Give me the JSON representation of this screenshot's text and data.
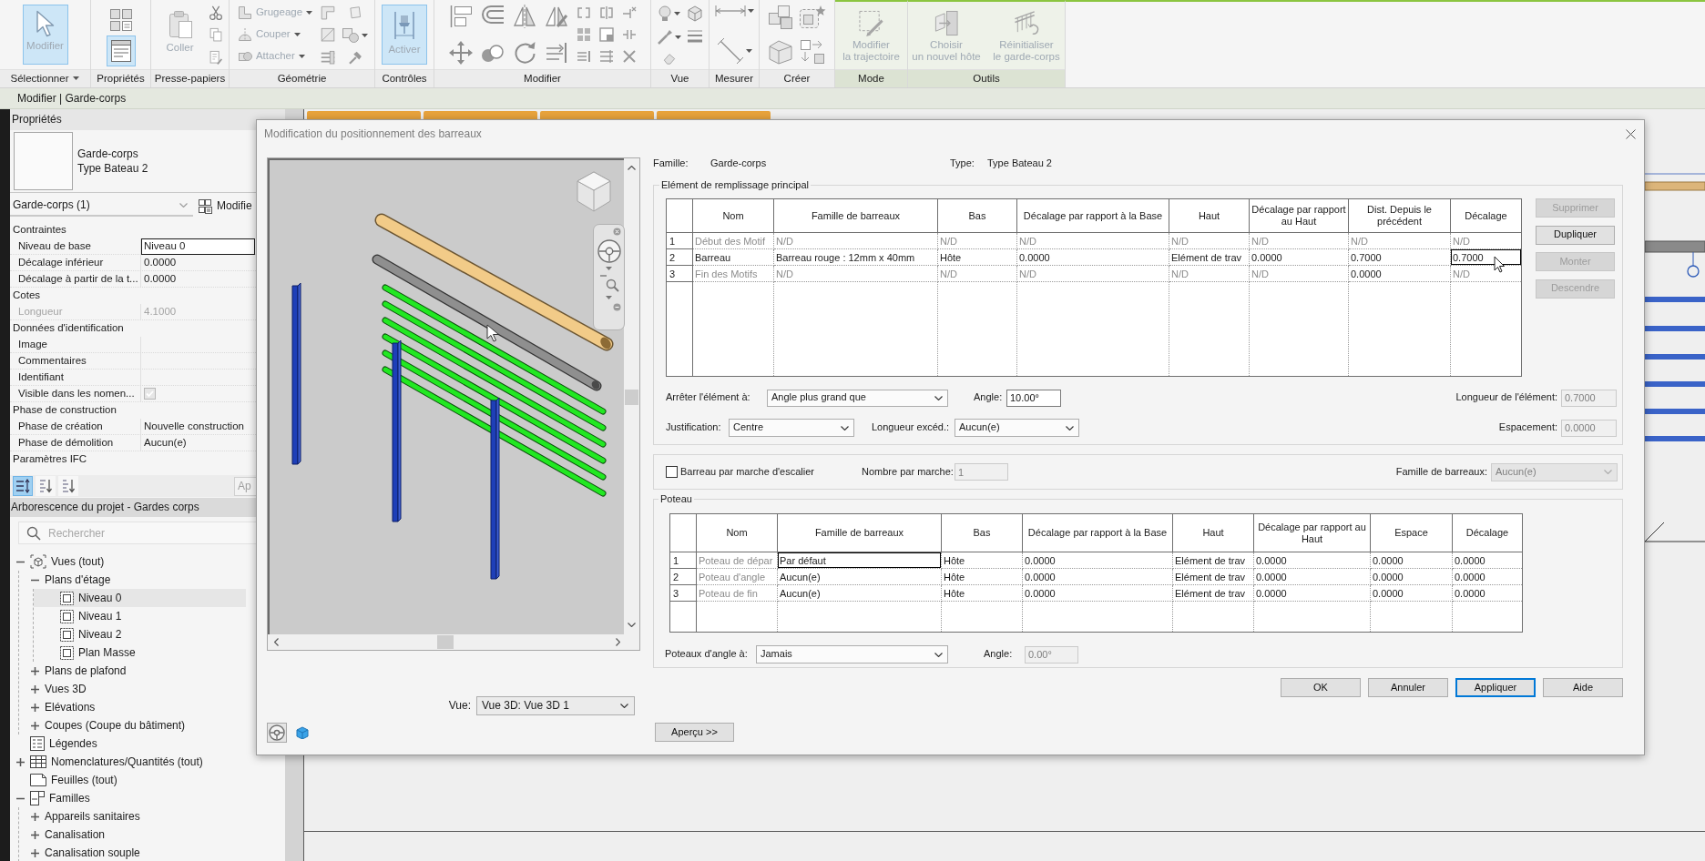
{
  "ribbon": {
    "panels": [
      {
        "label": "Sélectionner",
        "dropdown": true,
        "contextual": false,
        "buttons": [
          {
            "label": "Modifier",
            "selected": true,
            "disabled": true
          }
        ]
      },
      {
        "label": "Propriétés",
        "dropdown": false,
        "contextual": false,
        "tools": [
          {
            "selected": false
          },
          {
            "selected": true
          }
        ]
      },
      {
        "label": "Presse-papiers",
        "dropdown": false,
        "contextual": false,
        "buttons": [
          {
            "label": "Coller",
            "selected": false,
            "disabled": true
          }
        ]
      },
      {
        "label": "Géométrie",
        "dropdown": false,
        "contextual": false,
        "buttons": [
          {
            "label": "Grugeage",
            "selected": false,
            "disabled": true
          },
          {
            "label": "Couper",
            "selected": false,
            "disabled": true
          },
          {
            "label": "Attacher",
            "selected": false,
            "disabled": true
          }
        ]
      },
      {
        "label": "Contrôles",
        "dropdown": false,
        "contextual": false,
        "buttons": [
          {
            "label": "Activer",
            "selected": true,
            "disabled": true
          }
        ]
      },
      {
        "label": "Modifier",
        "dropdown": false,
        "contextual": false
      },
      {
        "label": "Vue",
        "dropdown": false,
        "contextual": false
      },
      {
        "label": "Mesurer",
        "dropdown": false,
        "contextual": false
      },
      {
        "label": "Créer",
        "dropdown": false,
        "contextual": false
      },
      {
        "label": "Mode",
        "dropdown": false,
        "contextual": true,
        "buttons": [
          {
            "label": "Modifier\nla trajectoire",
            "selected": false,
            "disabled": true
          }
        ]
      },
      {
        "label": "Outils",
        "dropdown": false,
        "contextual": true,
        "buttons": [
          {
            "label": "Choisir\nun nouvel hôte",
            "selected": false,
            "disabled": true
          },
          {
            "label": "Réinitialiser\nle garde-corps",
            "selected": false,
            "disabled": true
          }
        ]
      }
    ]
  },
  "context_bar": {
    "text": "Modifier | Garde-corps"
  },
  "properties": {
    "title": "Propriétés",
    "type_family": "Garde-corps",
    "type_name": "Type Bateau 2",
    "instance_selector": "Garde-corps (1)",
    "edit_type_button": "Modifie",
    "groups": [
      {
        "name": "Contraintes",
        "rows": [
          {
            "label": "Niveau de base",
            "value": "Niveau 0",
            "kind": "text",
            "focused": true,
            "disabled": false
          },
          {
            "label": "Décalage inférieur",
            "value": "0.0000",
            "kind": "text",
            "focused": false,
            "disabled": false
          },
          {
            "label": "Décalage à partir de la t...",
            "value": "0.0000",
            "kind": "text",
            "focused": false,
            "disabled": false
          }
        ]
      },
      {
        "name": "Cotes",
        "rows": [
          {
            "label": "Longueur",
            "value": "4.1000",
            "kind": "text",
            "focused": false,
            "disabled": true
          }
        ]
      },
      {
        "name": "Données d'identification",
        "rows": [
          {
            "label": "Image",
            "kind": "text",
            "focused": false,
            "disabled": false
          },
          {
            "label": "Commentaires",
            "kind": "text",
            "focused": false,
            "disabled": false
          },
          {
            "label": "Identifiant",
            "kind": "text",
            "focused": false,
            "disabled": false
          },
          {
            "label": "Visible dans les nomen...",
            "kind": "checkbox",
            "checked": true,
            "focused": false,
            "disabled": true
          }
        ]
      },
      {
        "name": "Phase de construction",
        "rows": [
          {
            "label": "Phase de création",
            "value": "Nouvelle construction",
            "kind": "text",
            "focused": false,
            "disabled": false
          },
          {
            "label": "Phase de démolition",
            "value": "Aucun(e)",
            "kind": "text",
            "focused": false,
            "disabled": false
          }
        ]
      },
      {
        "name": "Paramètres IFC"
      }
    ],
    "sort_tools": [
      {
        "selected": true
      },
      {
        "selected": false
      },
      {
        "selected": false
      }
    ],
    "apply_button": "Ap"
  },
  "project_browser": {
    "title": "Arborescence du projet - Gardes corps",
    "search": {
      "placeholder": "Rechercher"
    },
    "tree": [
      {
        "label": "Vues (tout)",
        "kind": "views",
        "expanded": true,
        "selected": false,
        "children": [
          {
            "label": "Plans d'étage",
            "expanded": true,
            "selected": false,
            "children": [
              {
                "label": "Niveau 0",
                "kind": "plan",
                "selected": true
              },
              {
                "label": "Niveau 1",
                "kind": "plan",
                "selected": false
              },
              {
                "label": "Niveau 2",
                "kind": "plan",
                "selected": false
              },
              {
                "label": "Plan Masse",
                "kind": "plan",
                "selected": false
              }
            ]
          },
          {
            "label": "Plans de plafond",
            "expanded": false,
            "selected": false
          },
          {
            "label": "Vues 3D",
            "expanded": false,
            "selected": false
          },
          {
            "label": "Elévations",
            "expanded": false,
            "selected": false
          },
          {
            "label": "Coupes (Coupe du bâtiment)",
            "expanded": false,
            "selected": false
          }
        ]
      },
      {
        "label": "Légendes",
        "kind": "legends",
        "selected": false
      },
      {
        "label": "Nomenclatures/Quantités (tout)",
        "kind": "schedules",
        "expanded": false,
        "selected": false
      },
      {
        "label": "Feuilles (tout)",
        "kind": "sheets",
        "selected": false
      },
      {
        "label": "Familles",
        "kind": "families",
        "expanded": true,
        "selected": false,
        "children": [
          {
            "label": "Appareils sanitaires",
            "expanded": false,
            "selected": false
          },
          {
            "label": "Canalisation",
            "expanded": false,
            "selected": false
          },
          {
            "label": "Canalisation souple",
            "expanded": false,
            "selected": false
          }
        ]
      }
    ]
  },
  "dialog": {
    "title": "Modification du positionnement des barreaux",
    "view_label": "Vue:",
    "view_select": "Vue 3D: Vue 3D 1",
    "family_label": "Famille:",
    "family": "Garde-corps",
    "type_label": "Type:",
    "type": "Type Bateau 2",
    "main_pattern": {
      "legend": "Elément de remplissage principal",
      "columns": [
        "Nom",
        "Famille de barreaux",
        "Bas",
        "Décalage par rapport à la Base",
        "Haut",
        "Décalage par rapport au Haut",
        "Dist. Depuis le précédent",
        "Décalage"
      ],
      "rows": [
        {
          "number": "1",
          "cells": [
            {
              "text": "Début des Motif",
              "disabled": true,
              "selected": false
            },
            {
              "text": "N/D",
              "disabled": true,
              "selected": false
            },
            {
              "text": "N/D",
              "disabled": true,
              "selected": false
            },
            {
              "text": "N/D",
              "disabled": true,
              "selected": false
            },
            {
              "text": "N/D",
              "disabled": true,
              "selected": false
            },
            {
              "text": "N/D",
              "disabled": true,
              "selected": false
            },
            {
              "text": "N/D",
              "disabled": true,
              "selected": false
            },
            {
              "text": "N/D",
              "disabled": true,
              "selected": false
            }
          ]
        },
        {
          "number": "2",
          "cells": [
            {
              "text": "Barreau",
              "disabled": false,
              "selected": false
            },
            {
              "text": "Barreau rouge : 12mm x 40mm",
              "disabled": false,
              "selected": false
            },
            {
              "text": "Hôte",
              "disabled": false,
              "selected": false
            },
            {
              "text": "0.0000",
              "disabled": false,
              "selected": false
            },
            {
              "text": "Elément de trav",
              "disabled": false,
              "selected": false
            },
            {
              "text": "0.0000",
              "disabled": false,
              "selected": false
            },
            {
              "text": "0.7000",
              "disabled": false,
              "selected": false
            },
            {
              "text": "0.7000",
              "disabled": false,
              "selected": true
            }
          ]
        },
        {
          "number": "3",
          "cells": [
            {
              "text": "Fin des Motifs",
              "disabled": true,
              "selected": false
            },
            {
              "text": "N/D",
              "disabled": true,
              "selected": false
            },
            {
              "text": "N/D",
              "disabled": true,
              "selected": false
            },
            {
              "text": "N/D",
              "disabled": true,
              "selected": false
            },
            {
              "text": "N/D",
              "disabled": true,
              "selected": false
            },
            {
              "text": "N/D",
              "disabled": true,
              "selected": false
            },
            {
              "text": "0.0000",
              "disabled": false,
              "selected": false
            },
            {
              "text": "N/D",
              "disabled": true,
              "selected": false
            }
          ]
        }
      ],
      "side_buttons": [
        {
          "label": "Supprimer",
          "disabled": true
        },
        {
          "label": "Dupliquer",
          "disabled": false
        },
        {
          "label": "Monter",
          "disabled": true
        },
        {
          "label": "Descendre",
          "disabled": true
        }
      ],
      "break_at": {
        "label": "Arrêter l'élément à:",
        "value": "Angle plus grand que",
        "disabled": false
      },
      "angle": {
        "label": "Angle:",
        "value": "10.00°",
        "disabled": false
      },
      "element_length": {
        "label": "Longueur de l'élément:",
        "value": "0.7000",
        "disabled": true
      },
      "justification": {
        "label": "Justification:",
        "value": "Centre",
        "disabled": false
      },
      "excess_length": {
        "label": "Longueur excéd.:",
        "value": "Aucun(e)",
        "disabled": false
      },
      "spacing": {
        "label": "Espacement:",
        "value": "0.0000",
        "disabled": true
      }
    },
    "stair": {
      "checkbox": {
        "label": "Barreau par marche d'escalier",
        "checked": false
      },
      "per_tread": {
        "label": "Nombre par marche:",
        "value": "1",
        "disabled": true
      },
      "family": {
        "label": "Famille de barreaux:",
        "value": "Aucun(e)",
        "disabled": true
      }
    },
    "posts": {
      "legend": "Poteau",
      "columns": [
        "Nom",
        "Famille de barreaux",
        "Bas",
        "Décalage par rapport à la Base",
        "Haut",
        "Décalage par rapport au Haut",
        "Espace",
        "Décalage"
      ],
      "rows": [
        {
          "number": "1",
          "cells": [
            {
              "text": "Poteau de dépar",
              "disabled": true,
              "selected": false
            },
            {
              "text": "Par défaut",
              "disabled": false,
              "selected": true
            },
            {
              "text": "Hôte",
              "disabled": false,
              "selected": false
            },
            {
              "text": "0.0000",
              "disabled": false,
              "selected": false
            },
            {
              "text": "Elément de trav",
              "disabled": false,
              "selected": false
            },
            {
              "text": "0.0000",
              "disabled": false,
              "selected": false
            },
            {
              "text": "0.0000",
              "disabled": false,
              "selected": false
            },
            {
              "text": "0.0000",
              "disabled": false,
              "selected": false
            }
          ]
        },
        {
          "number": "2",
          "cells": [
            {
              "text": "Poteau d'angle",
              "disabled": true,
              "selected": false
            },
            {
              "text": "Aucun(e)",
              "disabled": false,
              "selected": false
            },
            {
              "text": "Hôte",
              "disabled": false,
              "selected": false
            },
            {
              "text": "0.0000",
              "disabled": false,
              "selected": false
            },
            {
              "text": "Elément de trav",
              "disabled": false,
              "selected": false
            },
            {
              "text": "0.0000",
              "disabled": false,
              "selected": false
            },
            {
              "text": "0.0000",
              "disabled": false,
              "selected": false
            },
            {
              "text": "0.0000",
              "disabled": false,
              "selected": false
            }
          ]
        },
        {
          "number": "3",
          "cells": [
            {
              "text": "Poteau de fin",
              "disabled": true,
              "selected": false
            },
            {
              "text": "Aucun(e)",
              "disabled": false,
              "selected": false
            },
            {
              "text": "Hôte",
              "disabled": false,
              "selected": false
            },
            {
              "text": "0.0000",
              "disabled": false,
              "selected": false
            },
            {
              "text": "Elément de trav",
              "disabled": false,
              "selected": false
            },
            {
              "text": "0.0000",
              "disabled": false,
              "selected": false
            },
            {
              "text": "0.0000",
              "disabled": false,
              "selected": false
            },
            {
              "text": "0.0000",
              "disabled": false,
              "selected": false
            }
          ]
        }
      ],
      "corner_posts": {
        "label": "Poteaux d'angle à:",
        "value": "Jamais",
        "disabled": false
      },
      "angle": {
        "label": "Angle:",
        "value": "0.00°",
        "disabled": true
      }
    },
    "buttons": [
      {
        "label": "OK",
        "default": false
      },
      {
        "label": "Annuler",
        "default": false
      },
      {
        "label": "Appliquer",
        "default": true
      },
      {
        "label": "Aide",
        "default": false
      }
    ],
    "preview_button": "Aperçu >>"
  }
}
